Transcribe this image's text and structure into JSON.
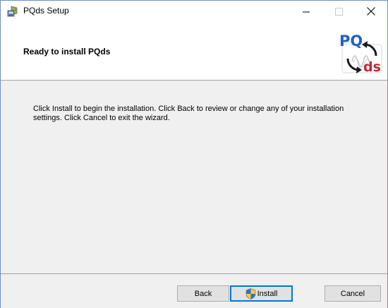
{
  "window": {
    "title": "PQds Setup"
  },
  "banner": {
    "title": "Ready to install PQds",
    "logo": {
      "text_top": "PQ",
      "text_bottom": "ds"
    }
  },
  "body": {
    "message": "Click Install to begin the installation. Click Back to review or change any of your installation settings. Click Cancel to exit the wizard."
  },
  "buttons": {
    "back": "Back",
    "install": "Install",
    "cancel": "Cancel"
  },
  "colors": {
    "logo_blue": "#1f5fd6",
    "logo_red": "#c0282d",
    "focus_border": "#0078d7"
  },
  "icons": {
    "app": "installer-icon",
    "install": "uac-shield-icon"
  }
}
